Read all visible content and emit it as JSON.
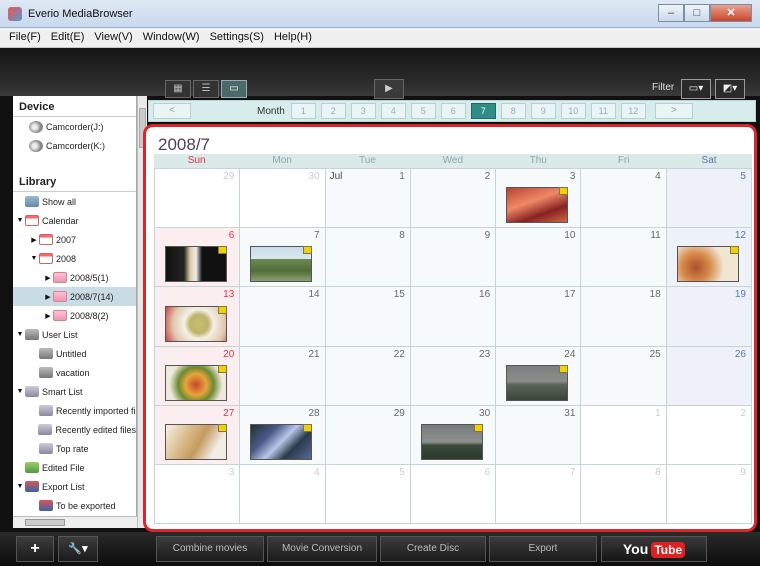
{
  "window": {
    "title": "Everio MediaBrowser",
    "controls": [
      "–",
      "□",
      "✕"
    ]
  },
  "menu": [
    "File(F)",
    "Edit(E)",
    "View(V)",
    "Window(W)",
    "Settings(S)",
    "Help(H)"
  ],
  "toolbar": {
    "view_modes": [
      {
        "name": "thumbnail-view",
        "glyph": "▦"
      },
      {
        "name": "list-view",
        "glyph": "☰"
      },
      {
        "name": "calendar-view",
        "glyph": "▭",
        "active": true
      }
    ],
    "filter_label": "Filter",
    "filter_buttons": [
      "▭▾",
      "◩▾"
    ]
  },
  "sidebar": {
    "device_title": "Device",
    "devices": [
      "Camcorder(J:)",
      "Camcorder(K:)"
    ],
    "library_title": "Library",
    "library": [
      {
        "label": "Show all",
        "icon": "lib",
        "indent": 0,
        "arrow": ""
      },
      {
        "label": "Calendar",
        "icon": "cal",
        "indent": 0,
        "arrow": "▼"
      },
      {
        "label": "2007",
        "icon": "cal",
        "indent": 1,
        "arrow": "▶"
      },
      {
        "label": "2008",
        "icon": "cal",
        "indent": 1,
        "arrow": "▼"
      },
      {
        "label": "2008/5(1)",
        "icon": "folder",
        "indent": 2,
        "arrow": "▶"
      },
      {
        "label": "2008/7(14)",
        "icon": "folder",
        "indent": 2,
        "arrow": "▶",
        "selected": true
      },
      {
        "label": "2008/8(2)",
        "icon": "folder",
        "indent": 2,
        "arrow": "▶"
      },
      {
        "label": "User List",
        "icon": "user",
        "indent": 0,
        "arrow": "▼"
      },
      {
        "label": "Untitled",
        "icon": "user",
        "indent": 1,
        "arrow": ""
      },
      {
        "label": "vacation",
        "icon": "user",
        "indent": 1,
        "arrow": ""
      },
      {
        "label": "Smart List",
        "icon": "smart",
        "indent": 0,
        "arrow": "▼"
      },
      {
        "label": "Recently imported fi",
        "icon": "smart",
        "indent": 1,
        "arrow": ""
      },
      {
        "label": "Recently edited files",
        "icon": "smart",
        "indent": 1,
        "arrow": ""
      },
      {
        "label": "Top rate",
        "icon": "smart",
        "indent": 1,
        "arrow": ""
      },
      {
        "label": "Edited File",
        "icon": "edit",
        "indent": 0,
        "arrow": ""
      },
      {
        "label": "Export List",
        "icon": "export",
        "indent": 0,
        "arrow": "▼"
      },
      {
        "label": "To be exported",
        "icon": "export",
        "indent": 1,
        "arrow": ""
      }
    ]
  },
  "monthbar": {
    "label": "Month",
    "prev": "<",
    "next": ">",
    "months": [
      "1",
      "2",
      "3",
      "4",
      "5",
      "6",
      "7",
      "8",
      "9",
      "10",
      "11",
      "12"
    ],
    "active_month": "7"
  },
  "calendar": {
    "title": "2008/7",
    "days": [
      "Sun",
      "Mon",
      "Tue",
      "Wed",
      "Thu",
      "Fri",
      "Sat"
    ],
    "month_cell_label": "Jul",
    "cells": [
      {
        "d": "29",
        "other": true
      },
      {
        "d": "30",
        "other": true
      },
      {
        "d": "1",
        "mlabel": true
      },
      {
        "d": "2"
      },
      {
        "d": "3",
        "thumb": "red"
      },
      {
        "d": "4"
      },
      {
        "d": "5"
      },
      {
        "d": "6",
        "thumb": "noodle"
      },
      {
        "d": "7",
        "thumb": "trees"
      },
      {
        "d": "8"
      },
      {
        "d": "9"
      },
      {
        "d": "10"
      },
      {
        "d": "11"
      },
      {
        "d": "12",
        "thumb": "food"
      },
      {
        "d": "13",
        "thumb": "soup"
      },
      {
        "d": "14"
      },
      {
        "d": "15"
      },
      {
        "d": "16"
      },
      {
        "d": "17"
      },
      {
        "d": "18"
      },
      {
        "d": "19"
      },
      {
        "d": "20",
        "thumb": "salad"
      },
      {
        "d": "21"
      },
      {
        "d": "22"
      },
      {
        "d": "23"
      },
      {
        "d": "24",
        "thumb": "field"
      },
      {
        "d": "25"
      },
      {
        "d": "26"
      },
      {
        "d": "27",
        "thumb": "bread"
      },
      {
        "d": "28",
        "thumb": "plant"
      },
      {
        "d": "29"
      },
      {
        "d": "30",
        "thumb": "land"
      },
      {
        "d": "31"
      },
      {
        "d": "1",
        "other": true
      },
      {
        "d": "2",
        "other": true
      },
      {
        "d": "3",
        "other": true
      },
      {
        "d": "4",
        "other": true
      },
      {
        "d": "5",
        "other": true
      },
      {
        "d": "6",
        "other": true
      },
      {
        "d": "7",
        "other": true
      },
      {
        "d": "8",
        "other": true
      },
      {
        "d": "9",
        "other": true
      }
    ]
  },
  "bottom": {
    "add_glyph": "+",
    "tools_glyph": "🔧▾",
    "actions": [
      "Combine movies",
      "Movie Conversion",
      "Create Disc",
      "Export"
    ],
    "youtube_you": "You",
    "youtube_tube": "Tube"
  },
  "colors": {
    "calendar_border": "#d9262b",
    "accent": "#2f8c86",
    "sunday": "#d34",
    "saturday": "#57a"
  }
}
